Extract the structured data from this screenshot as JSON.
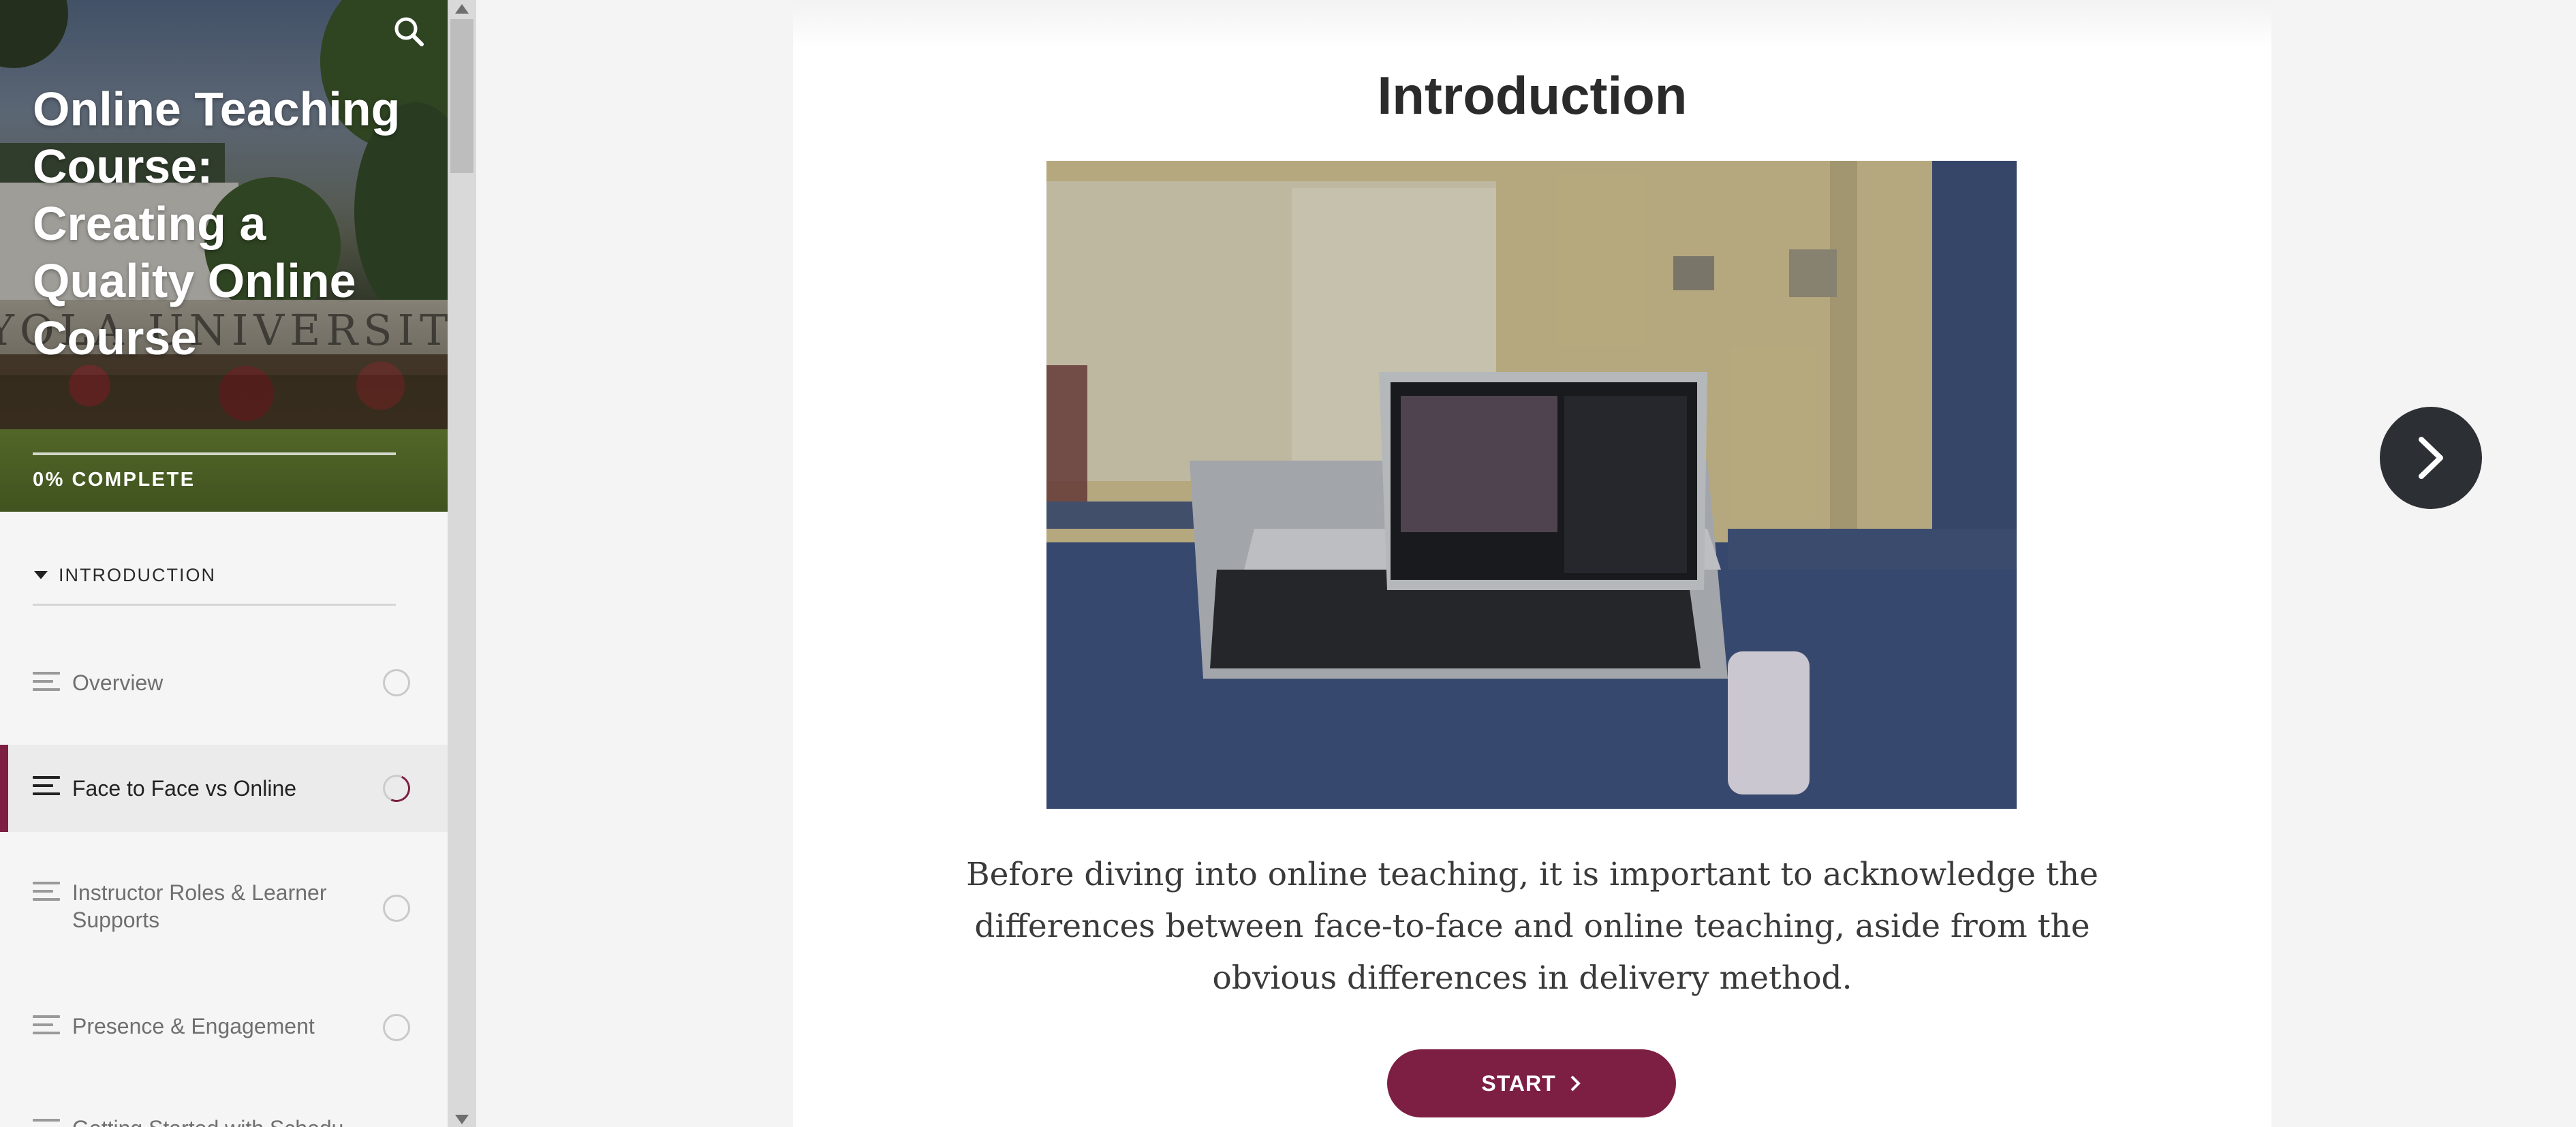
{
  "sidebar": {
    "course_title": "Online Teaching Course: Creating a Quality Online Course",
    "progress_percent": 0,
    "progress_text": "0% COMPLETE",
    "hero_wall_text": "YOLA UNIVERSITY CH",
    "search_icon": "search-icon",
    "section": {
      "label": "INTRODUCTION",
      "expanded": true
    },
    "lessons": [
      {
        "label": "Overview",
        "status": "not-started",
        "active": false
      },
      {
        "label": "Face to Face vs Online",
        "status": "in-progress",
        "active": true
      },
      {
        "label": "Instructor Roles & Learner Supports",
        "status": "not-started",
        "active": false
      },
      {
        "label": "Presence & Engagement",
        "status": "not-started",
        "active": false
      },
      {
        "label": "Getting Started with Schedu",
        "status": "not-started",
        "active": false
      }
    ]
  },
  "main": {
    "lesson_title": "Introduction",
    "lesson_text": "Before diving into online teaching, it is important to acknowledge the differences between face-to-face and online teaching, aside from the obvious differences in delivery method.",
    "start_label": "START",
    "next_icon": "chevron-right-icon"
  },
  "colors": {
    "accent": "#7d1f43",
    "next_button": "#2c2f33",
    "sidebar_bg": "#f5f5f5",
    "page_bg": "#f4f4f4"
  }
}
